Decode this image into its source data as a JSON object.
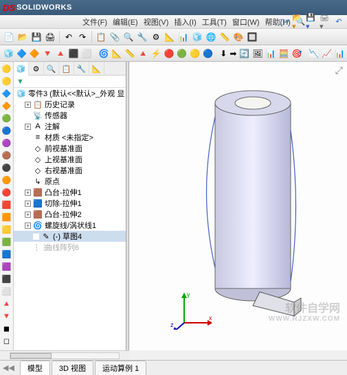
{
  "app": {
    "brand": "SOLIDWORKS",
    "logo_glyph": "DS"
  },
  "menus": [
    "文件(F)",
    "编辑(E)",
    "视图(V)",
    "插入(I)",
    "工具(T)",
    "窗口(W)",
    "帮助(H)"
  ],
  "title_right_icons": [
    "new",
    "open",
    "save",
    "print",
    "undo"
  ],
  "toolbar1_icons": [
    "📄",
    "📂",
    "💾",
    "🖨",
    "|",
    "↶",
    "↷",
    "|",
    "📋",
    "📎",
    "🔍",
    "🔧",
    "⚙",
    "📐",
    "📊",
    "🧊",
    "🌐",
    "📏",
    "🎨",
    "🔲"
  ],
  "toolbar2_icons": [
    "🧊",
    "🔷",
    "🔶",
    "🔻",
    "🔺",
    "⬛",
    "⬜",
    "|",
    "🌀",
    "📐",
    "📏",
    "🔺",
    "⚡",
    "🔴",
    "🟢",
    "🟡",
    "🔵",
    "|",
    "⬇",
    "➡",
    "🔄",
    "🖼",
    "📊",
    "🧮",
    "🎯",
    "|",
    "📉",
    "📈",
    "📊",
    "🔳",
    "🔲",
    "⏹",
    "▶",
    "⏸"
  ],
  "left_rail_icons": [
    "🟡",
    "🟡",
    "🔷",
    "🔶",
    "🟢",
    "🔵",
    "🟣",
    "🟤",
    "⚫",
    "🟠",
    "🔴",
    "🟥",
    "🟧",
    "🟨",
    "🟩",
    "🟦",
    "🟪",
    "⬛",
    "⬜",
    "🔺",
    "🔻",
    "◼",
    "◻"
  ],
  "panel_tabs_icons": [
    "🧊",
    "⚙",
    "🔍",
    "📋",
    "🔧",
    "📐"
  ],
  "tree": {
    "root": "零件3  (默认<<默认>_外观 显",
    "items": [
      {
        "icon": "📋",
        "label": "历史记录",
        "exp": "+"
      },
      {
        "icon": "📡",
        "label": "传感器",
        "exp": ""
      },
      {
        "icon": "A",
        "label": "注解",
        "exp": "+"
      },
      {
        "icon": "≡",
        "label": "材质 <未指定>",
        "exp": ""
      },
      {
        "icon": "◇",
        "label": "前视基准面",
        "exp": ""
      },
      {
        "icon": "◇",
        "label": "上视基准面",
        "exp": ""
      },
      {
        "icon": "◇",
        "label": "右视基准面",
        "exp": ""
      },
      {
        "icon": "↳",
        "label": "原点",
        "exp": ""
      },
      {
        "icon": "🟫",
        "label": "凸台-拉伸1",
        "exp": "+"
      },
      {
        "icon": "🟦",
        "label": "切除-拉伸1",
        "exp": "+"
      },
      {
        "icon": "🟫",
        "label": "凸台-拉伸2",
        "exp": "+"
      },
      {
        "icon": "🌀",
        "label": "螺旋线/涡状线1",
        "exp": "+"
      },
      {
        "icon": "✎",
        "label": "(-) 草图4",
        "exp": "",
        "indent": 2,
        "selected": true
      },
      {
        "icon": "⋮⋮",
        "label": "曲线阵列6",
        "exp": "",
        "dim": true
      }
    ]
  },
  "triad": {
    "x": "x",
    "y": "y",
    "z": "z"
  },
  "watermark": {
    "main": "软件自学网",
    "sub": "WWW.RJZXW.COM"
  },
  "doc_tabs": [
    "模型",
    "3D 视图",
    "运动算例 1"
  ],
  "active_doc_tab": 0,
  "filter_label": "▼"
}
